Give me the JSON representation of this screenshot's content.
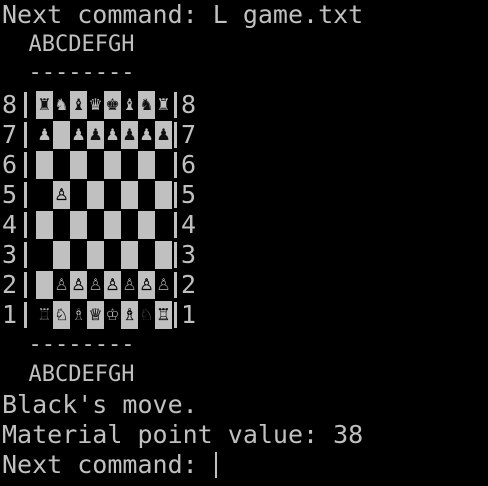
{
  "terminal": {
    "line1": "Next command: L game.txt",
    "files_top": "  ABCDEFGH",
    "dashes_top": "  --------",
    "dashes_bottom": "  --------",
    "files_bottom": "  ABCDEFGH",
    "status": "Black's move.",
    "material": "Material point value: 38",
    "prompt": "Next command: "
  },
  "board": {
    "ranks": [
      "8",
      "7",
      "6",
      "5",
      "4",
      "3",
      "2",
      "1"
    ],
    "rows": [
      [
        "♜",
        "♞",
        "♝",
        "♛",
        "♚",
        "♝",
        "♞",
        "♜"
      ],
      [
        "♟",
        "",
        "♟",
        "♟",
        "♟",
        "♟",
        "♟",
        "♟"
      ],
      [
        "",
        "",
        "",
        "",
        "",
        "",
        "",
        ""
      ],
      [
        "",
        "♙",
        "",
        "",
        "",
        "",
        "",
        ""
      ],
      [
        "",
        "",
        "",
        "",
        "",
        "",
        "",
        ""
      ],
      [
        "",
        "",
        "",
        "",
        "",
        "",
        "",
        ""
      ],
      [
        "",
        "♙",
        "♙",
        "♙",
        "♙",
        "♙",
        "♙",
        "♙"
      ],
      [
        "♖",
        "♘",
        "♗",
        "♕",
        "♔",
        "♗",
        "♘",
        "♖"
      ]
    ],
    "colors": {
      "light_square": "#c0c0c0",
      "dark_square": "#000000",
      "text": "#c0c0c0"
    }
  }
}
